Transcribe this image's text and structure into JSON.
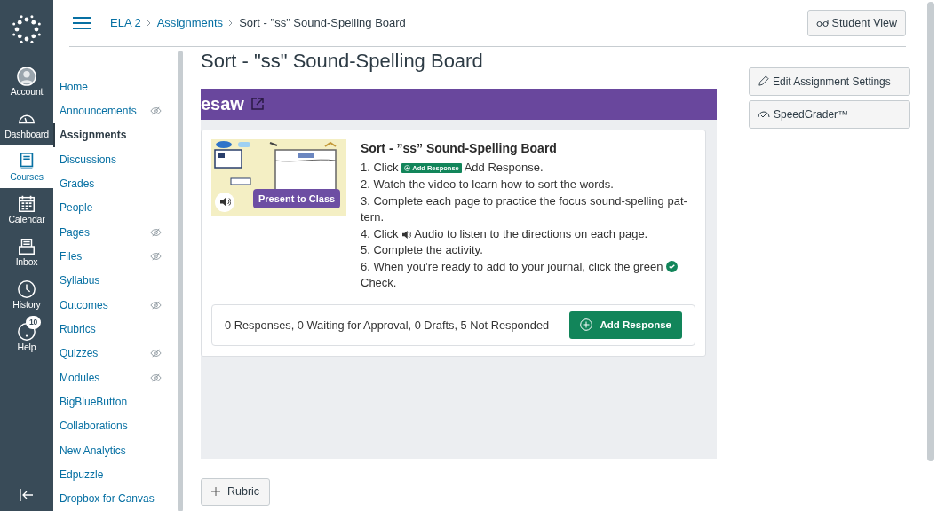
{
  "global_nav": {
    "items": [
      {
        "label": "Account",
        "kind": "avatar",
        "selected": false
      },
      {
        "label": "Dashboard",
        "kind": "gauge",
        "selected": false
      },
      {
        "label": "Courses",
        "kind": "book",
        "selected": true
      },
      {
        "label": "Calendar",
        "kind": "calendar",
        "selected": false
      },
      {
        "label": "Inbox",
        "kind": "inbox",
        "selected": false
      },
      {
        "label": "History",
        "kind": "clock",
        "selected": false
      },
      {
        "label": "Help",
        "kind": "help",
        "selected": false,
        "badge": "10"
      }
    ]
  },
  "header": {
    "breadcrumbs": [
      "ELA 2",
      "Assignments",
      "Sort - \"ss\" Sound-Spelling Board"
    ],
    "student_view_button": "Student View"
  },
  "course_nav": [
    {
      "label": "Home",
      "selected": false,
      "hidden": false
    },
    {
      "label": "Announcements",
      "selected": false,
      "hidden": true
    },
    {
      "label": "Assignments",
      "selected": true,
      "hidden": false
    },
    {
      "label": "Discussions",
      "selected": false,
      "hidden": false
    },
    {
      "label": "Grades",
      "selected": false,
      "hidden": false
    },
    {
      "label": "People",
      "selected": false,
      "hidden": false
    },
    {
      "label": "Pages",
      "selected": false,
      "hidden": true
    },
    {
      "label": "Files",
      "selected": false,
      "hidden": true
    },
    {
      "label": "Syllabus",
      "selected": false,
      "hidden": false
    },
    {
      "label": "Outcomes",
      "selected": false,
      "hidden": true
    },
    {
      "label": "Rubrics",
      "selected": false,
      "hidden": false
    },
    {
      "label": "Quizzes",
      "selected": false,
      "hidden": true
    },
    {
      "label": "Modules",
      "selected": false,
      "hidden": true
    },
    {
      "label": "BigBlueButton",
      "selected": false,
      "hidden": false
    },
    {
      "label": "Collaborations",
      "selected": false,
      "hidden": false
    },
    {
      "label": "New Analytics",
      "selected": false,
      "hidden": false
    },
    {
      "label": "Edpuzzle",
      "selected": false,
      "hidden": false
    },
    {
      "label": "Dropbox for Canvas",
      "selected": false,
      "hidden": false
    }
  ],
  "page": {
    "title": "Sort - \"ss\" Sound-Spelling Board",
    "embed": {
      "brand": "esaw",
      "card": {
        "thumbnail": {
          "kind": "picture",
          "present_button": "Present to Class"
        },
        "title": "Sort - ”ss” Sound-Spelling Board",
        "steps": [
          {
            "before": "1. Click",
            "inline": {
              "kind": "badge",
              "label": "Add Response"
            },
            "after": "Add Response."
          },
          {
            "before": "2. Watch the video to learn how to sort the words."
          },
          {
            "before": "3. Complete each page to practice the focus sound-spelling pat-tern."
          },
          {
            "before": "4. Click",
            "inline": {
              "kind": "audio"
            },
            "after": "Audio to listen to the directions on each page."
          },
          {
            "before": "5. Complete the activity."
          },
          {
            "before": "6. When you’re ready to add to your journal, click the green",
            "inline": {
              "kind": "check"
            },
            "after": "Check."
          }
        ],
        "summary": "0 Responses, 0 Waiting for Approval, 0 Drafts, 5 Not Responded",
        "add_button": "Add Response"
      }
    },
    "rubric_button": "Rubric"
  },
  "sidebar_buttons": [
    {
      "label": "Edit Assignment Settings",
      "kind": "pencil"
    },
    {
      "label": "SpeedGrader™",
      "kind": "speedgrader"
    }
  ]
}
